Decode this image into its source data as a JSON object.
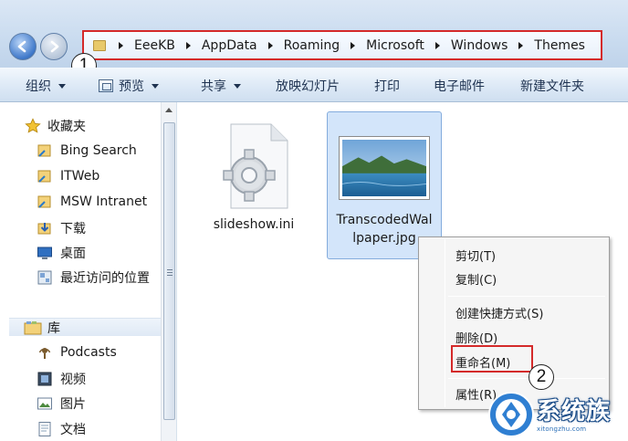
{
  "address": {
    "crumbs": [
      "EeeKB",
      "AppData",
      "Roaming",
      "Microsoft",
      "Windows",
      "Themes"
    ]
  },
  "callouts": {
    "first": "1",
    "second": "2"
  },
  "toolbar": {
    "organize": "组织",
    "preview": "预览",
    "share": "共享",
    "slideshow": "放映幻灯片",
    "print": "打印",
    "email": "电子邮件",
    "new_folder": "新建文件夹"
  },
  "sidebar": {
    "favorites": "收藏夹",
    "favorite_items": [
      "Bing Search",
      "ITWeb",
      "MSW Intranet",
      "下载",
      "桌面",
      "最近访问的位置"
    ],
    "libraries": "库",
    "library_items": [
      "Podcasts",
      "视频",
      "图片",
      "文档"
    ]
  },
  "files": [
    {
      "name": "slideshow.ini",
      "icon": "settings-file-icon"
    },
    {
      "name_line1": "TranscodedWal",
      "name_line2": "lpaper.jpg",
      "icon": "image-thumbnail"
    }
  ],
  "context_menu": {
    "cut": "剪切(T)",
    "copy": "复制(C)",
    "create_shortcut": "创建快捷方式(S)",
    "delete": "删除(D)",
    "rename": "重命名(M)",
    "properties": "属性(R)"
  },
  "watermark": {
    "title": "系统族",
    "url": "xitongzhu.com"
  },
  "colors": {
    "highlight_red": "#d42a2a",
    "selection_blue": "#d3e5fa",
    "toolbar_blue": "#dde9f6"
  }
}
